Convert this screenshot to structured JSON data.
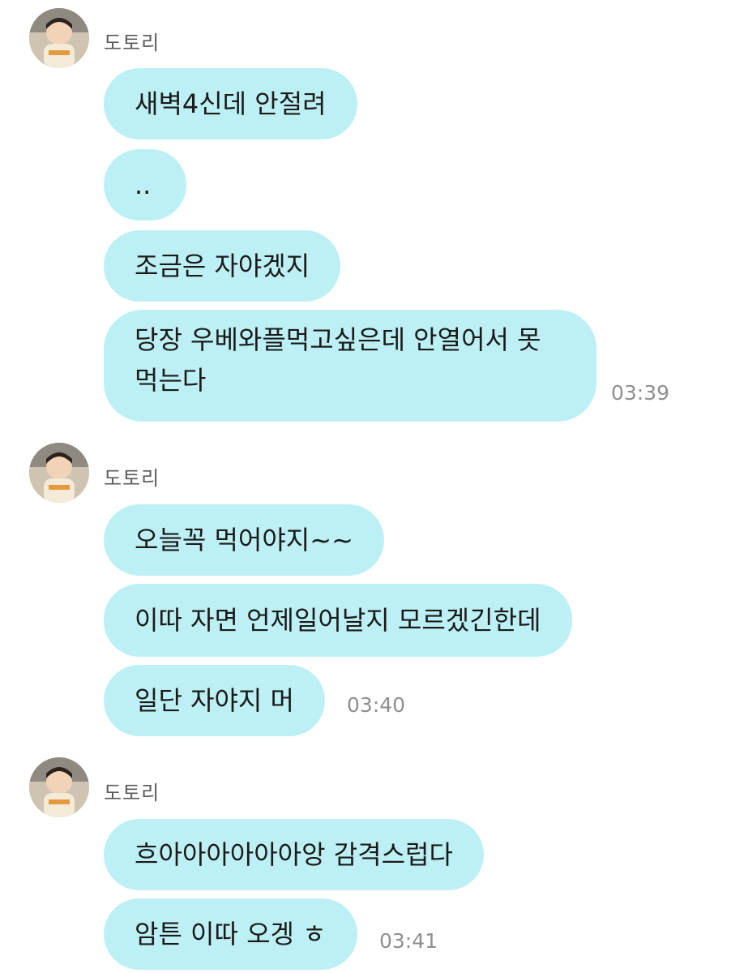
{
  "sender_name": "도토리",
  "colors": {
    "bubble": "#bdf0f4",
    "sender_text": "#5a5a5a",
    "timestamp_text": "#8e8e93",
    "background": "#ffffff"
  },
  "groups": [
    {
      "messages": [
        "새벽4신데 안절려",
        "..",
        "조금은 자야겠지",
        "당장 우베와플먹고싶은데 안열어서 못 먹는다"
      ],
      "time": "03:39"
    },
    {
      "messages": [
        "오늘꼭 먹어야지~~",
        "이따 자면 언제일어날지 모르겠긴한데",
        "일단 자야지 머"
      ],
      "time": "03:40"
    },
    {
      "messages": [
        "흐아아아아아아앙 감격스럽다",
        "암튼 이따 오겡 ㅎ"
      ],
      "time": "03:41"
    }
  ]
}
